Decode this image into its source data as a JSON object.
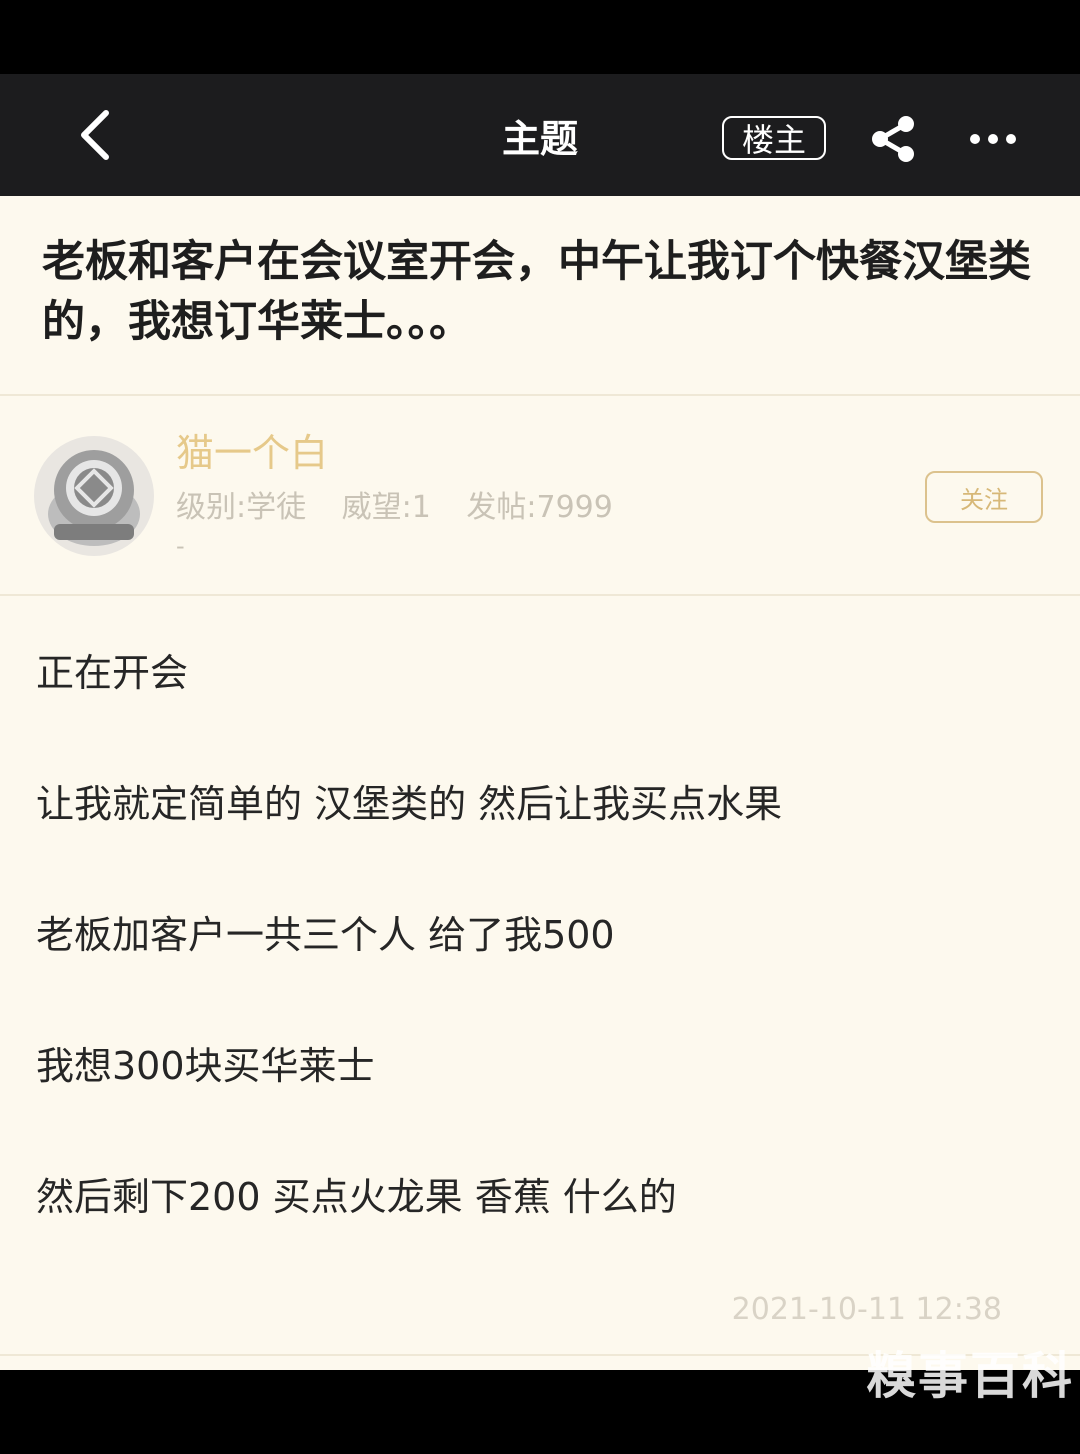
{
  "header": {
    "title": "主题",
    "op_button": "楼主"
  },
  "thread": {
    "title": "老板和客户在会议室开会，中午让我订个快餐汉堡类的，我想订华莱士。。。"
  },
  "author": {
    "name": "猫一个白",
    "level": "级别:学徒",
    "prestige": "威望:1",
    "posts": "发帖:7999",
    "signature": "-",
    "follow_label": "关注"
  },
  "post": {
    "lines": [
      "正在开会",
      "让我就定简单的 汉堡类的 然后让我买点水果",
      "老板加客户一共三个人 给了我500",
      "我想300块买华莱士",
      "然后剩下200 买点火龙果 香蕉 什么的"
    ],
    "timestamp": "2021-10-11 12:38"
  },
  "watermark": "糗事百科",
  "icons": [
    "back-arrow-icon",
    "share-icon",
    "more-icon",
    "avatar-helmet-icon"
  ]
}
